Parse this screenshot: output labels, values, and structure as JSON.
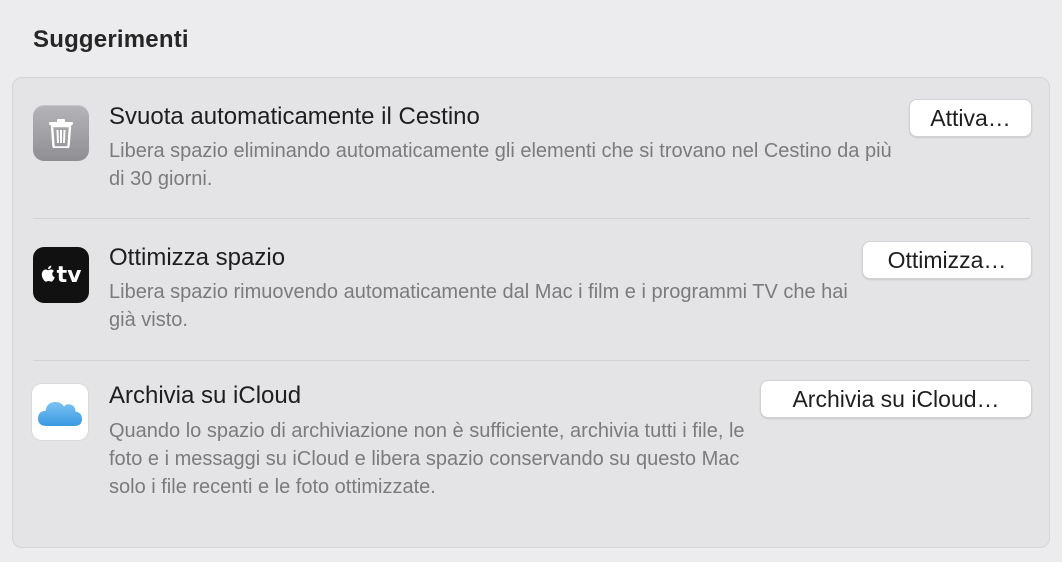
{
  "section": {
    "title": "Suggerimenti"
  },
  "items": [
    {
      "icon": "trash-icon",
      "title": "Svuota automaticamente il Cestino",
      "description": "Libera spazio eliminando automaticamente gli elementi che si trovano nel Cestino da più di 30 giorni.",
      "button_label": "Attiva…"
    },
    {
      "icon": "apple-tv-icon",
      "icon_label": "tv",
      "title": "Ottimizza spazio",
      "description": "Libera spazio rimuovendo automaticamente dal Mac i film e i programmi TV che hai già visto.",
      "button_label": "Ottimizza…"
    },
    {
      "icon": "icloud-icon",
      "title": "Archivia su iCloud",
      "description": "Quando lo spazio di archiviazione non è sufficiente, archivia tutti i file, le foto e i messaggi su iCloud e libera spazio conservando su questo Mac solo i file recenti e le foto ottimizzate.",
      "button_label": "Archivia su iCloud…"
    }
  ],
  "colors": {
    "background": "#ecebed",
    "panel": "#e4e3e6",
    "title_text": "#1e1e1e",
    "secondary_text": "#7b7b7e",
    "icloud_blue": "#4aa4e6"
  }
}
